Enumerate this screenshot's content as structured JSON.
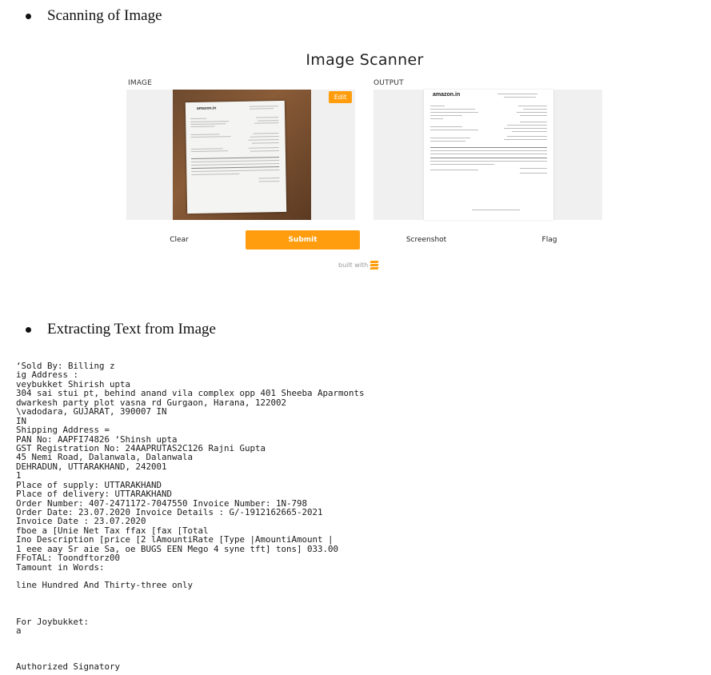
{
  "sections": {
    "scanning_heading": "Scanning of Image",
    "extracting_heading": "Extracting Text from Image"
  },
  "app": {
    "title": "Image Scanner",
    "image_label": "IMAGE",
    "output_label": "OUTPUT",
    "edit_label": "Edit",
    "clear_label": "Clear",
    "submit_label": "Submit",
    "screenshot_label": "Screenshot",
    "flag_label": "Flag",
    "built_with": "built with",
    "logo_text": "amazon.in",
    "accent_color": "#ff9d0e"
  },
  "ocr_text": {
    "lines_a": [
      "‘Sold By: Billing z",
      "ig Address :",
      "veybukket Shirish upta",
      "304 sai stui pt, behind anand vila complex opp 401 Sheeba Aparmonts",
      "dwarkesh party plot vasna rd Gurgaon, Harana, 122002",
      "\\vadodara, GUJARAT, 390007 IN",
      "IN",
      "Shipping Address =",
      "PAN No: AAPFI74826 ‘Shinsh upta",
      "GST Registration No: 24AAPRUTAS2C126 Rajni Gupta",
      "45 Nemi Road, Dalanwala, Dalanwala",
      "DEHRADUN, UTTARAKHAND, 242001",
      "1",
      "Place of supply: UTTARAKHAND",
      "Place of delivery: UTTARAKHAND",
      "Order Number: 407-2471172-7047550 Invoice Number: 1N-798",
      "Order Date: 23.07.2020 Invoice Details : G/-1912162665-2021",
      "Invoice Date : 23.07.2020",
      "fboe a [Unie Net Tax ffax [fax [Total",
      "Ino Description [price [2 lAmountiRate [Type |AmountiAmount |",
      "1 eee aay Sr aie Sa, oe BUGS EEN Mego 4 syne tft] tons] 033.00",
      "FFoTAL: Toondftorz00",
      "Tamount in Words:"
    ],
    "line_words": "line Hundred And Thirty-three only",
    "line_for": "For Joybukket:",
    "line_a": "a",
    "line_sign": "Authorized Signatory"
  }
}
